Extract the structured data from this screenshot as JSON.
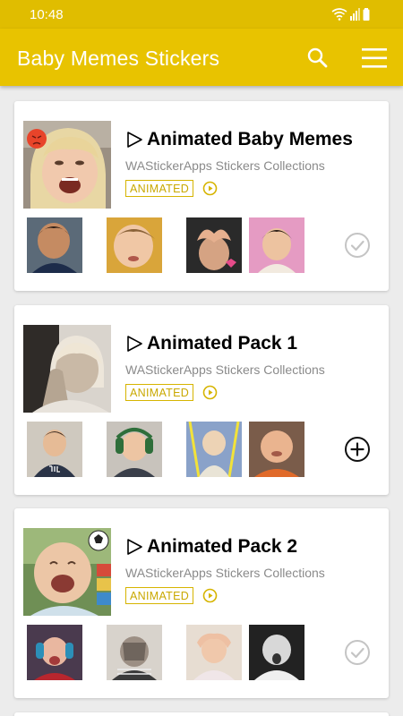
{
  "status_bar": {
    "time": "10:48",
    "icons": [
      "wifi-icon",
      "signal-icon",
      "battery-icon"
    ]
  },
  "app_bar": {
    "title": "Baby Memes Stickers",
    "actions": [
      "search-icon",
      "menu-icon"
    ]
  },
  "colors": {
    "primary": "#e8c300",
    "status_bar": "#e0bd00",
    "badge": "#c9a800",
    "subtitle": "#8a8a8a",
    "background": "#ececec"
  },
  "packs": [
    {
      "title": "Animated Baby Memes",
      "publisher": "WAStickerApps Stickers Collections",
      "badge": "ANIMATED",
      "action": "added-check-icon",
      "cover": "screaming-girl-cover",
      "stickers": [
        "sticker-boy",
        "sticker-toddler",
        "sticker-heart-hands",
        "sticker-pink-girl"
      ]
    },
    {
      "title": "Animated Pack 1",
      "publisher": "WAStickerApps Stickers Collections",
      "badge": "ANIMATED",
      "action": "add-icon",
      "cover": "girl-hand-face-cover",
      "stickers": [
        "sticker-til-girl",
        "sticker-headphones-baby",
        "sticker-glow-baby",
        "sticker-smiling-baby"
      ]
    },
    {
      "title": "Animated Pack 2",
      "publisher": "WAStickerApps Stickers Collections",
      "badge": "ANIMATED",
      "action": "added-check-icon",
      "cover": "laughing-baby-cover",
      "stickers": [
        "sticker-crying-baby",
        "sticker-facepalm-baby",
        "sticker-hands-head-baby",
        "sticker-surprised-baby"
      ]
    }
  ]
}
